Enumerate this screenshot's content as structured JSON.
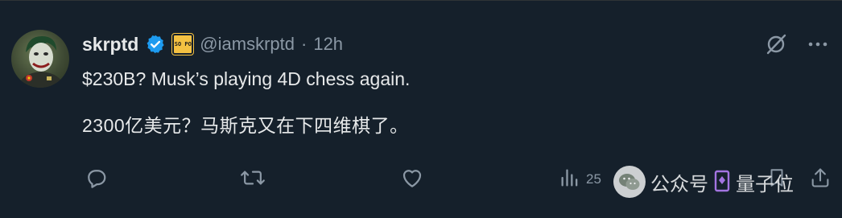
{
  "tweet": {
    "author": {
      "name": "skrptd",
      "handle": "@iamskrptd",
      "separator": "·",
      "time": "12h",
      "affiliate_badge_text": "SO PO"
    },
    "text_line1": "$230B? Musk’s playing 4D chess again.",
    "text_line2": "2300亿美元？马斯克又在下四维棋了。",
    "actions": {
      "reply_icon": "reply-icon",
      "retweet_icon": "retweet-icon",
      "like_icon": "heart-icon",
      "views_icon": "bar-chart-icon",
      "views_count": "25",
      "bookmark_icon": "bookmark-icon",
      "share_icon": "share-icon"
    },
    "top_icons": [
      "grok-icon",
      "more-icon"
    ]
  },
  "watermark": {
    "text_left": "公众号",
    "text_right": "量子位"
  },
  "colors": {
    "background": "#15202b",
    "text": "#e7e9ea",
    "secondary": "#8b98a5",
    "verified": "#1d9bf0",
    "badge": "#f4c142"
  }
}
